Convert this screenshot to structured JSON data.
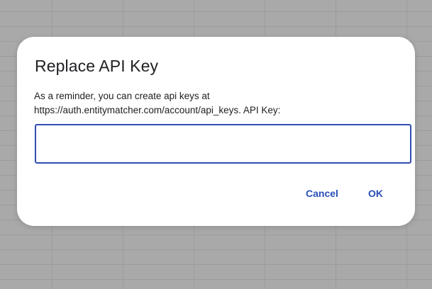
{
  "dialog": {
    "title": "Replace API Key",
    "message_line1": "As a reminder, you can create api keys at",
    "message_line2": "https://auth.entitymatcher.com/account/api_keys. API Key:",
    "input_value": "",
    "input_placeholder": "",
    "cancel_label": "Cancel",
    "ok_label": "OK"
  },
  "colors": {
    "accent": "#2a4fb8",
    "backdrop": "#a9a9a9",
    "dialog_bg": "#ffffff"
  }
}
